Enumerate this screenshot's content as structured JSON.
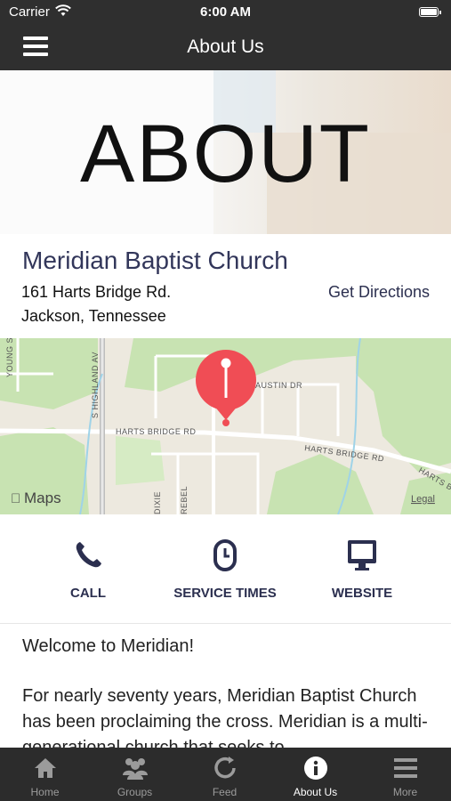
{
  "status_bar": {
    "carrier": "Carrier",
    "time": "6:00 AM"
  },
  "nav": {
    "title": "About Us",
    "menu_icon": "hamburger-menu-icon"
  },
  "hero": {
    "title": "ABOUT"
  },
  "church": {
    "name": "Meridian Baptist Church",
    "address_line1": "161 Harts Bridge Rd.",
    "address_line2": "Jackson, Tennessee",
    "directions_label": "Get Directions"
  },
  "map": {
    "attribution": "Maps",
    "legal": "Legal",
    "streets": {
      "harts_bridge_left": "HARTS BRIDGE RD",
      "harts_bridge_right": "HARTS BRIDGE RD",
      "harts_bridge_far": "HARTS BRIDGE",
      "austin": "AUSTIN DR",
      "highland": "S HIGHLAND AV",
      "young": "YOUNG ST",
      "dixie": "DIXIE",
      "rebel": "REBEL"
    }
  },
  "actions": [
    {
      "label": "CALL",
      "icon": "phone-icon"
    },
    {
      "label": "SERVICE TIMES",
      "icon": "clock-icon"
    },
    {
      "label": "WEBSITE",
      "icon": "monitor-icon"
    }
  ],
  "body_text": {
    "greeting": "Welcome to Meridian!",
    "paragraph": "For nearly seventy years, Meridian Baptist Church has been proclaiming the cross. Meridian is a multi-generational church that seeks to"
  },
  "tabs": [
    {
      "label": "Home",
      "icon": "home-icon",
      "active": false
    },
    {
      "label": "Groups",
      "icon": "groups-icon",
      "active": false
    },
    {
      "label": "Feed",
      "icon": "feed-icon",
      "active": false
    },
    {
      "label": "About Us",
      "icon": "info-icon",
      "active": true
    },
    {
      "label": "More",
      "icon": "more-icon",
      "active": false
    }
  ],
  "colors": {
    "bar_background": "#2f2f2f",
    "accent_text": "#32365a",
    "map_pin": "#f04d55",
    "tab_inactive": "#9b9b9b",
    "tab_active": "#ffffff"
  }
}
